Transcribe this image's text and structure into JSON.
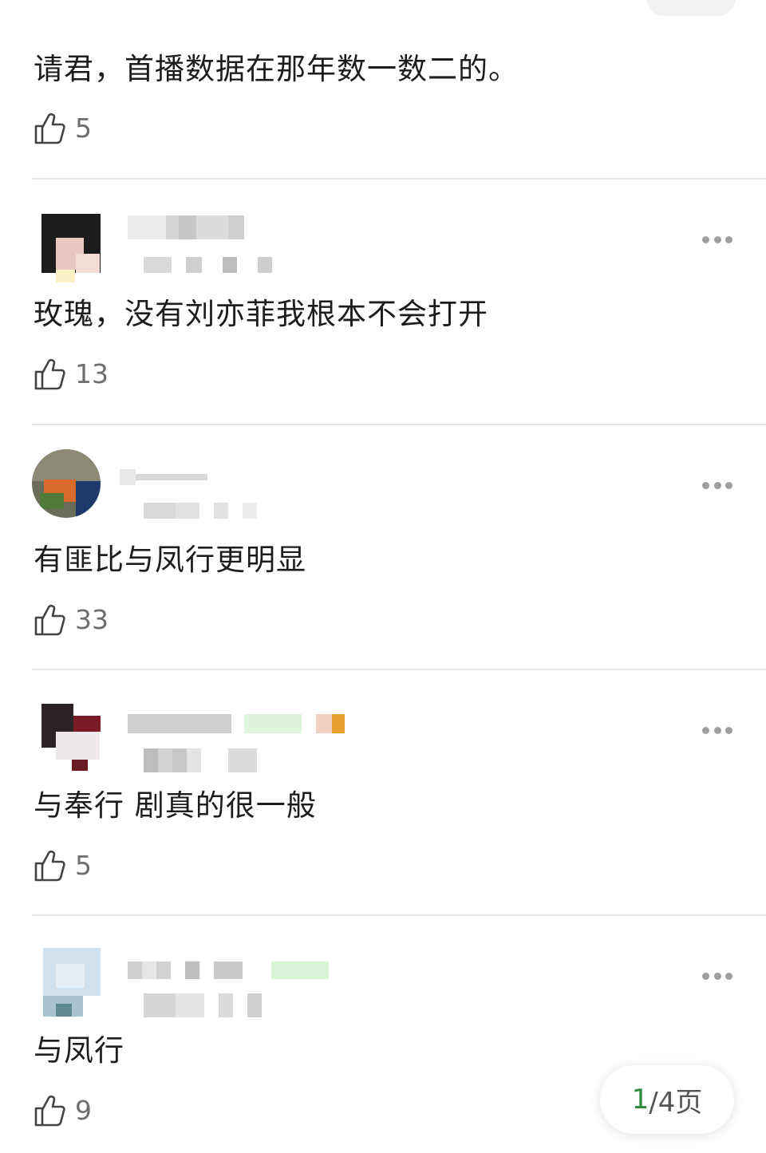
{
  "comments": [
    {
      "text": "请君，首播数据在那年数一数二的。",
      "likes": "5"
    },
    {
      "text": "玫瑰，没有刘亦菲我根本不会打开",
      "likes": "13"
    },
    {
      "text": "有匪比与凤行更明显",
      "likes": "33"
    },
    {
      "text": "与奉行 剧真的很一般",
      "likes": "5"
    },
    {
      "text": "与凤行",
      "likes": "9"
    }
  ],
  "pager": {
    "current": "1",
    "rest": "/4页"
  },
  "icons": {
    "like": "thumbs-up-icon",
    "more": "more-dots-icon"
  },
  "colors": {
    "pager_current": "#2e8b3e",
    "like_count": "#6e6e6e",
    "divider": "#e6e6e6"
  }
}
